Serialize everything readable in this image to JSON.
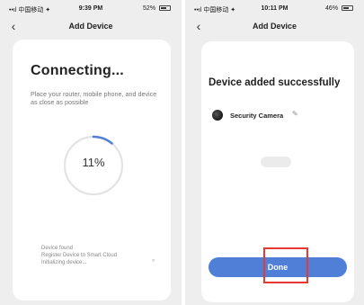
{
  "left_screen": {
    "status": {
      "carrier": "••ıl 中国移动 ✦",
      "time": "9:39 PM",
      "battery": "52%"
    },
    "nav": {
      "back_icon": "chevron-left-icon",
      "title": "Add Device"
    },
    "heading": "Connecting...",
    "description": "Place your router, mobile phone, and device as close as possible",
    "progress": {
      "percent": 11,
      "label": "11%"
    },
    "steps": [
      "Device found",
      "Register Device to Smart Cloud",
      "Initializing device..."
    ],
    "mark": "»"
  },
  "right_screen": {
    "status": {
      "carrier": "••ıl 中国移动 ✦",
      "time": "10:11 PM",
      "battery": "46%"
    },
    "nav": {
      "back_icon": "chevron-left-icon",
      "title": "Add Device"
    },
    "heading": "Device added successfully",
    "device": {
      "name": "Security Camera",
      "edit_icon": "pencil-icon"
    },
    "done_label": "Done"
  },
  "colors": {
    "accent": "#4f7fd6",
    "progress_track": "#e3e3e3",
    "highlight": "#e53935",
    "background": "#eeeeef"
  }
}
